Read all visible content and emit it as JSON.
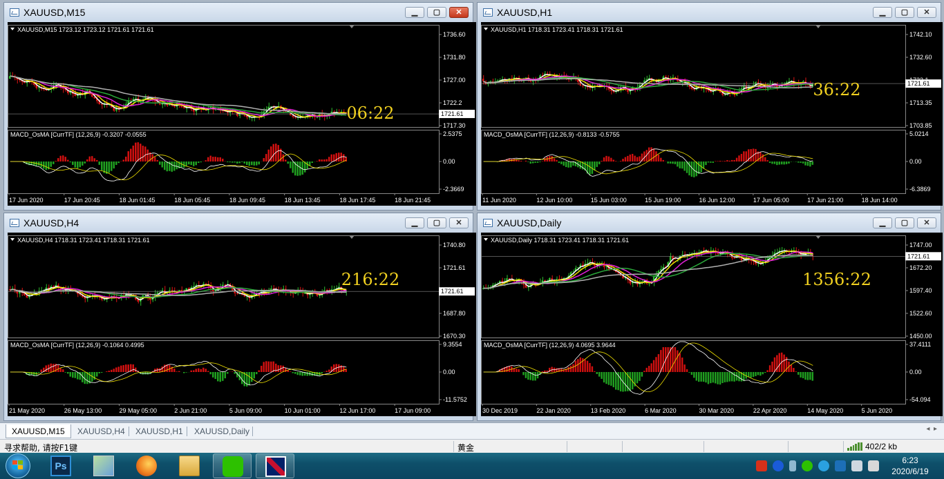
{
  "colors": {
    "bull_candle": "#2fbf2f",
    "bear_candle": "#e01414",
    "ma_white": "#ffffff",
    "ma_yellow": "#f0e000",
    "ma_magenta": "#e020d8",
    "ma_green": "#2aa83a",
    "ma_gray": "#b0b0b0",
    "macd_signal": "#f0e000",
    "macd_line": "#ffffff",
    "hist_pos": "#d01010",
    "hist_neg": "#20a020",
    "countdown": "#f0d020",
    "chart_bg": "#000000",
    "axis_text": "#ffffff"
  },
  "windows": [
    {
      "title": "XAUUSD,M15",
      "header": "XAUUSD,M15  1723.12 1723.12 1721.61 1721.61",
      "macd_header": "MACD_OsMA [CurrTF] (12,26,9) -0.3207 -0.0555",
      "price_ticks": [
        "1736.60",
        "1731.80",
        "1727.00",
        "1722.2",
        "1717.30"
      ],
      "current_price": "1721.61",
      "macd_ticks": [
        "2.5375",
        "0.00",
        "-2.3669"
      ],
      "time_labels": [
        "17 Jun 2020",
        "17 Jun 20:45",
        "18 Jun 01:45",
        "18 Jun 05:45",
        "18 Jun 09:45",
        "18 Jun 13:45",
        "18 Jun 17:45",
        "18 Jun 21:45"
      ],
      "countdown": "06:22",
      "active_close": true
    },
    {
      "title": "XAUUSD,H1",
      "header": "XAUUSD,H1  1718.31 1723.41 1718.31 1721.61",
      "macd_header": "MACD_OsMA [CurrTF] (12,26,9) -0.8133 -0.5755",
      "price_ticks": [
        "1742.10",
        "1732.60",
        "1723.1",
        "1713.35",
        "1703.85"
      ],
      "current_price": "1721.61",
      "macd_ticks": [
        "5.0214",
        "0.00",
        "-6.3869"
      ],
      "time_labels": [
        "11 Jun 2020",
        "12 Jun 10:00",
        "15 Jun 03:00",
        "15 Jun 19:00",
        "16 Jun 12:00",
        "17 Jun 05:00",
        "17 Jun 21:00",
        "18 Jun 14:00"
      ],
      "countdown": "36:22",
      "active_close": false
    },
    {
      "title": "XAUUSD,H4",
      "header": "XAUUSD,H4  1718.31 1723.41 1718.31 1721.61",
      "macd_header": "MACD_OsMA [CurrTF] (12,26,9) -0.1064 0.4995",
      "price_ticks": [
        "1740.80",
        "1721.61",
        "1705.30",
        "1687.80",
        "1670.30"
      ],
      "current_price": "1721.61",
      "macd_ticks": [
        "9.3554",
        "0.00",
        "-11.5752"
      ],
      "time_labels": [
        "21 May 2020",
        "26 May 13:00",
        "29 May 05:00",
        "2 Jun 21:00",
        "5 Jun 09:00",
        "10 Jun 01:00",
        "12 Jun 17:00",
        "17 Jun 09:00"
      ],
      "countdown": "216:22",
      "active_close": false
    },
    {
      "title": "XAUUSD,Daily",
      "header": "XAUUSD,Daily  1718.31 1723.41 1718.31 1721.61",
      "macd_header": "MACD_OsMA [CurrTF] (12,26,9) 4.0695 3.9644",
      "price_ticks": [
        "1747.00",
        "1672.20",
        "1597.40",
        "1522.60",
        "1450.00"
      ],
      "current_price": "1721.61",
      "macd_ticks": [
        "37.4111",
        "0.00",
        "-54.094"
      ],
      "time_labels": [
        "30 Dec 2019",
        "22 Jan 2020",
        "13 Feb 2020",
        "6 Mar 2020",
        "30 Mar 2020",
        "22 Apr 2020",
        "14 May 2020",
        "5 Jun 2020"
      ],
      "countdown": "1356:22",
      "active_close": false
    }
  ],
  "tabs": [
    "XAUUSD,M15",
    "XAUUSD,H4",
    "XAUUSD,H1",
    "XAUUSD,Daily"
  ],
  "status": {
    "help": "寻求帮助, 请按F1键",
    "profile": "黄金",
    "traffic": "402/2 kb"
  },
  "taskbar": {
    "apps": [
      "windows-explorer",
      "photoshop",
      "map-app",
      "firefox",
      "file-manager",
      "wechat",
      "uk-flag-app"
    ],
    "clock_time": "6:23",
    "clock_date": "2020/6/19"
  }
}
